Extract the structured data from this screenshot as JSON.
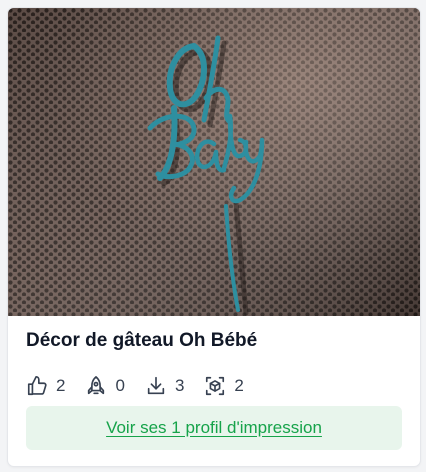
{
  "model": {
    "title": "Décor de gâteau Oh Bébé",
    "image_alt": "Oh Baby"
  },
  "stats": [
    {
      "icon": "thumbs-up-icon",
      "count": "2"
    },
    {
      "icon": "rocket-icon",
      "count": "0"
    },
    {
      "icon": "download-icon",
      "count": "3"
    },
    {
      "icon": "cube-icon",
      "count": "2"
    }
  ],
  "profile_button": {
    "label": "Voir ses 1 profil d'impression"
  },
  "colors": {
    "accent": "#16a34a",
    "button_bg": "#e8f5ec",
    "topper": "#2e8fa0"
  }
}
